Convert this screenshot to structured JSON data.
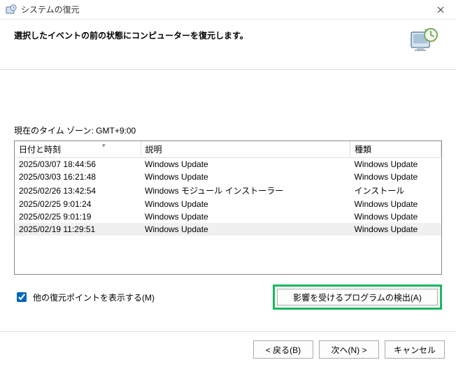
{
  "window": {
    "title": "システムの復元"
  },
  "header": {
    "text": "選択したイベントの前の状態にコンピューターを復元します。"
  },
  "timezone_label": "現在のタイム ゾーン: GMT+9:00",
  "table": {
    "columns": {
      "date": "日付と時刻",
      "desc": "説明",
      "type": "種類"
    },
    "rows": [
      {
        "date": "2025/03/07 18:44:56",
        "desc": "Windows Update",
        "type": "Windows Update",
        "selected": false
      },
      {
        "date": "2025/03/03 16:21:48",
        "desc": "Windows Update",
        "type": "Windows Update",
        "selected": false
      },
      {
        "date": "2025/02/26 13:42:54",
        "desc": "Windows モジュール インストーラー",
        "type": "インストール",
        "selected": false
      },
      {
        "date": "2025/02/25 9:01:24",
        "desc": "Windows Update",
        "type": "Windows Update",
        "selected": false
      },
      {
        "date": "2025/02/25 9:01:19",
        "desc": "Windows Update",
        "type": "Windows Update",
        "selected": false
      },
      {
        "date": "2025/02/19 11:29:51",
        "desc": "Windows Update",
        "type": "Windows Update",
        "selected": true
      }
    ]
  },
  "checkbox": {
    "label": "他の復元ポイントを表示する(M)",
    "checked": true
  },
  "buttons": {
    "scan": "影響を受けるプログラムの検出(A)",
    "back": "< 戻る(B)",
    "next": "次へ(N) >",
    "cancel": "キャンセル"
  }
}
